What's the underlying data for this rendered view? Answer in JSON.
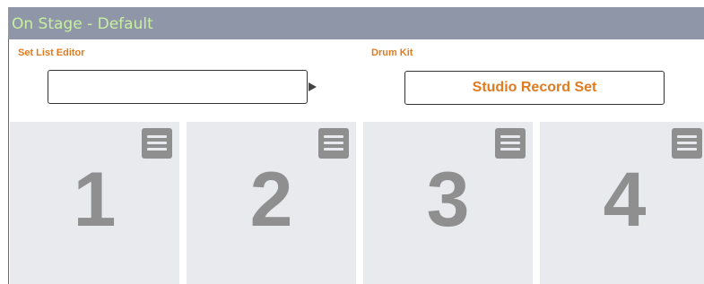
{
  "title": "On Stage - Default",
  "setlist": {
    "label": "Set List Editor",
    "value": ""
  },
  "drumkit": {
    "label": "Drum Kit",
    "button_label": "Studio Record Set"
  },
  "pads": [
    {
      "number": "1"
    },
    {
      "number": "2"
    },
    {
      "number": "3"
    },
    {
      "number": "4"
    }
  ],
  "colors": {
    "titlebar": "#8e96a7",
    "title_text": "#c8f0a0",
    "accent": "#e07b1f",
    "pad_bg": "#e8eaed",
    "pad_fg": "#8f8f8f"
  },
  "icons": {
    "pad_menu": "menu-icon",
    "setlist_next": "play-arrow-icon"
  }
}
